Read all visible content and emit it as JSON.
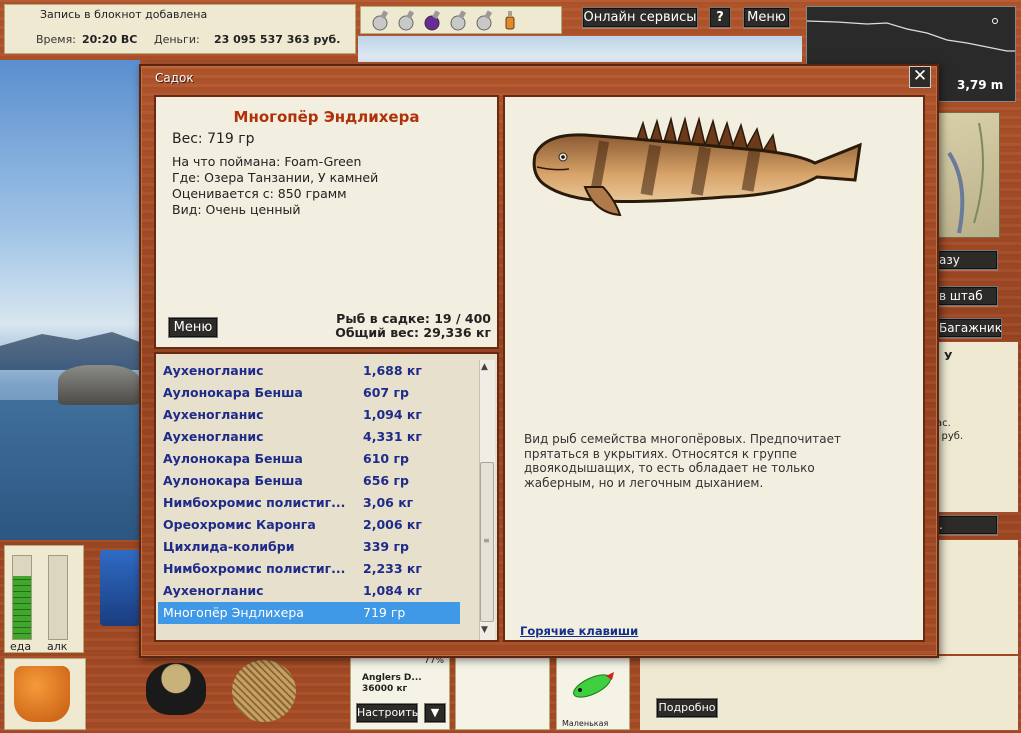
{
  "status": {
    "message": "Запись в блокнот добавлена",
    "time_label": "Время:",
    "time_value": "20:20 ВС",
    "money_label": "Деньги:",
    "money_value": "23 095 537 363 руб."
  },
  "toolbar": {
    "online_label": "Онлайн сервисы",
    "help_label": "?",
    "menu_label": "Меню"
  },
  "depth": {
    "value": "3,79 m"
  },
  "gauges": {
    "food_label": "еда",
    "alc_label": "алк",
    "food_level": 0.75
  },
  "dialog": {
    "title": "Садок",
    "close_glyph": "✕",
    "fish": {
      "name": "Многопёр Эндлихера",
      "weight": "Вес: 719 гр",
      "bait": "На что поймана: Foam-Green",
      "location": "Где: Озера Танзании, У камней",
      "valued_from": "Оценивается с: 850 грамм",
      "kind": "Вид: Очень ценный",
      "description": "Вид рыб семейства многопёровых. Предпочитает прятаться в укрытиях. Относятся к группе двоякодышащих, то есть обладает не только жаберным, но и легочным дыханием."
    },
    "menu_label": "Меню",
    "fish_count": "Рыб в садке: 19 / 400",
    "total_weight": "Общий вес: 29,336 кг",
    "hotkeys_label": "Горячие клавиши",
    "catch_list": [
      {
        "name": "Аухеногланис",
        "weight": "1,688 кг"
      },
      {
        "name": "Аулонокара Бенша",
        "weight": "607 гр"
      },
      {
        "name": "Аухеногланис",
        "weight": "1,094 кг"
      },
      {
        "name": "Аухеногланис",
        "weight": "4,331 кг"
      },
      {
        "name": "Аулонокара Бенша",
        "weight": "610 гр"
      },
      {
        "name": "Аулонокара Бенша",
        "weight": "656 гр"
      },
      {
        "name": "Нимбохромис полистиг...",
        "weight": "3,06 кг"
      },
      {
        "name": "Ореохромис Каронга",
        "weight": "2,006 кг"
      },
      {
        "name": "Цихлида-колибри",
        "weight": "339 гр"
      },
      {
        "name": "Нимбохромис полистиг...",
        "weight": "2,233 кг"
      },
      {
        "name": "Аухеногланис",
        "weight": "1,084 кг"
      },
      {
        "name": "Многопёр Эндлихера",
        "weight": "719 гр",
        "selected": true
      }
    ]
  },
  "right_side": {
    "btn1": "азу",
    "btn2": "в штаб",
    "btn3": "Багажник",
    "btn4": ".",
    "text1": "У",
    "text2": "ас.",
    "text3": "0 руб."
  },
  "bottom": {
    "tackle_name": "Anglers D...",
    "tackle_weight": "36000 кг",
    "tackle_pct": "77%",
    "setup_label": "Настроить",
    "setup_arrow": "▼",
    "small_label": "Маленькая",
    "details_label": "Подробно"
  },
  "colors": {
    "wood": "#a84d26",
    "fish_name": "#b0320a",
    "list_text": "#1e2b8a",
    "selected_row": "#3f99e6"
  }
}
